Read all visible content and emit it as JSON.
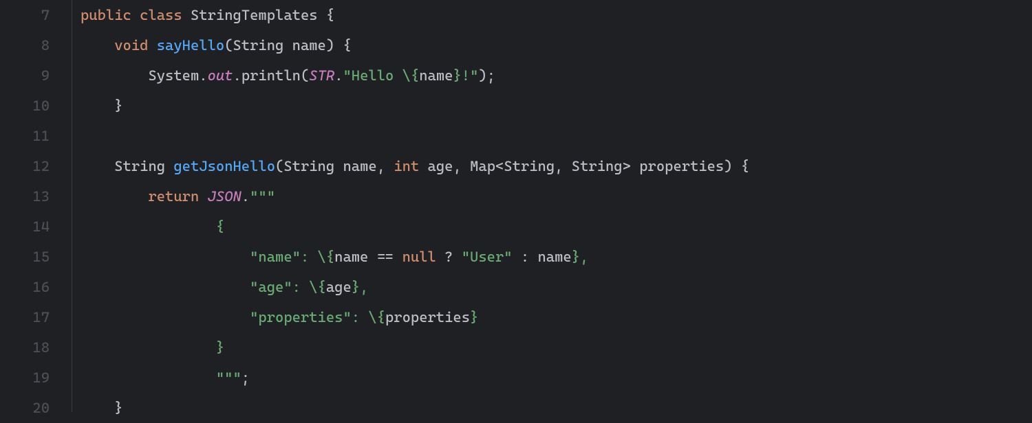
{
  "gutter": {
    "start": 7,
    "nums": [
      "7",
      "8",
      "9",
      "10",
      "11",
      "12",
      "13",
      "14",
      "15",
      "16",
      "17",
      "18",
      "19",
      "20"
    ]
  },
  "code": {
    "line7": {
      "kw1": "public",
      "sp1": " ",
      "kw2": "class",
      "sp2": " ",
      "cls": "StringTemplates",
      "sp3": " ",
      "brc": "{"
    },
    "line8": {
      "ind": "    ",
      "kw": "void",
      "sp1": " ",
      "fn": "sayHello",
      "op": "(",
      "type": "String",
      "sp2": " ",
      "param": "name",
      "cp": ")",
      "sp3": " ",
      "brc": "{"
    },
    "line9": {
      "ind": "        ",
      "sys": "System",
      "dot1": ".",
      "out": "out",
      "dot2": ".",
      "pr": "println",
      "op": "(",
      "str": "STR",
      "dot3": ".",
      "q1": "\"Hello \\{",
      "nm": "name",
      "q2": "}!\"",
      "cp": ")",
      "semi": ";"
    },
    "line10": {
      "ind": "    ",
      "brc": "}"
    },
    "line11": {
      "blank": " "
    },
    "line12": {
      "ind": "    ",
      "type1": "String",
      "sp1": " ",
      "fn": "getJsonHello",
      "op": "(",
      "type2": "String",
      "sp2": " ",
      "p1": "name",
      "c1": ",",
      "sp3": " ",
      "kw": "int",
      "sp4": " ",
      "p2": "age",
      "c2": ",",
      "sp5": " ",
      "type3": "Map",
      "lt": "<",
      "type4": "String",
      "c3": ",",
      "sp6": " ",
      "type5": "String",
      "gt": ">",
      "sp7": " ",
      "p3": "properties",
      "cp": ")",
      "sp8": " ",
      "brc": "{"
    },
    "line13": {
      "ind": "        ",
      "kw": "return",
      "sp": " ",
      "json": "JSON",
      "dot": ".",
      "q": "\"\"\""
    },
    "line14": {
      "ind": "                ",
      "brc": "{"
    },
    "line15": {
      "ind": "                    ",
      "q1": "\"name\": \\{",
      "nm": "name",
      "eq": " == ",
      "nul": "null",
      "tern": " ? ",
      "usr": "\"User\"",
      "col": " : ",
      "nm2": "name",
      "q2": "},"
    },
    "line16": {
      "ind": "                    ",
      "q1": "\"age\": \\{",
      "age": "age",
      "q2": "},"
    },
    "line17": {
      "ind": "                    ",
      "q1": "\"properties\": \\{",
      "prop": "properties",
      "q2": "}"
    },
    "line18": {
      "ind": "                ",
      "brc": "}"
    },
    "line19": {
      "ind": "                ",
      "q": "\"\"\"",
      "semi": ";"
    },
    "line20": {
      "ind": "    ",
      "brc": "}"
    }
  }
}
